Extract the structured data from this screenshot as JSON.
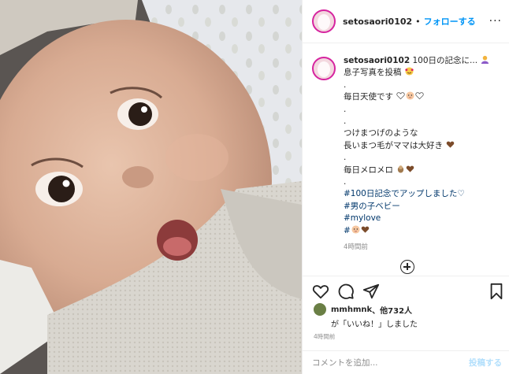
{
  "post": {
    "username": "setosaori0102",
    "separator": "•",
    "follow_label": "フォローする",
    "more_label": "···"
  },
  "caption": {
    "username": "setosaori0102",
    "line1": "100日の記念に...",
    "line2": "息子写真を投稿",
    "dot1": ".",
    "line3": "毎日天使です",
    "dot2": ".",
    "dot3": ".",
    "line4": "つけまつげのような",
    "line5": "長いまつ毛がママは大好き",
    "dot4": ".",
    "line6": "毎日メロメロ",
    "dot5": ".",
    "hashtags": [
      "#100日記念でアップしました♡",
      "#男の子ベビー",
      "#mylove",
      "#"
    ],
    "time": "4時間前"
  },
  "likes": {
    "user": "mmhmnk",
    "others": "、他732人",
    "suffix": "が「いいね！」しました"
  },
  "time_ago": "4時間前",
  "comment": {
    "placeholder": "コメントを追加...",
    "post_label": "投稿する"
  },
  "colors": {
    "accent": "#0095f6",
    "tag": "#00376b",
    "post_disabled": "#b2dffc",
    "story_ring": "#d6249f",
    "brown_heart": "#7b4b2a"
  },
  "icons": [
    "heart-icon",
    "comment-icon",
    "share-icon",
    "bookmark-icon",
    "plus-circle-icon",
    "more-icon"
  ]
}
